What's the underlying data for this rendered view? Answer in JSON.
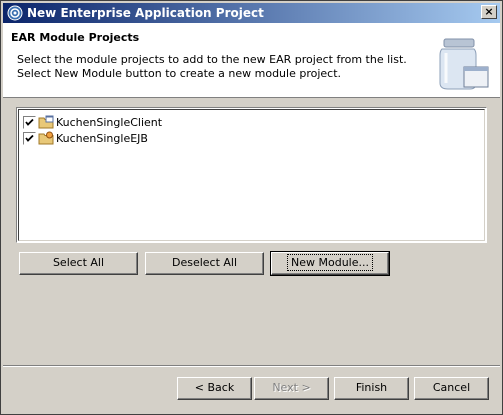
{
  "window": {
    "title": "New Enterprise Application Project",
    "close_label": "×"
  },
  "header": {
    "title": "EAR Module Projects",
    "desc_line1": "Select the module projects to add to the new EAR project from the list.",
    "desc_line2": "Select New Module button to create a new module project."
  },
  "modules": [
    {
      "name": "KuchenSingleClient",
      "checked": true
    },
    {
      "name": "KuchenSingleEJB",
      "checked": true
    }
  ],
  "buttons": {
    "select_all": "Select All",
    "deselect_all": "Deselect All",
    "new_module": "New Module...",
    "back": "< Back",
    "next": "Next >",
    "finish": "Finish",
    "cancel": "Cancel"
  }
}
